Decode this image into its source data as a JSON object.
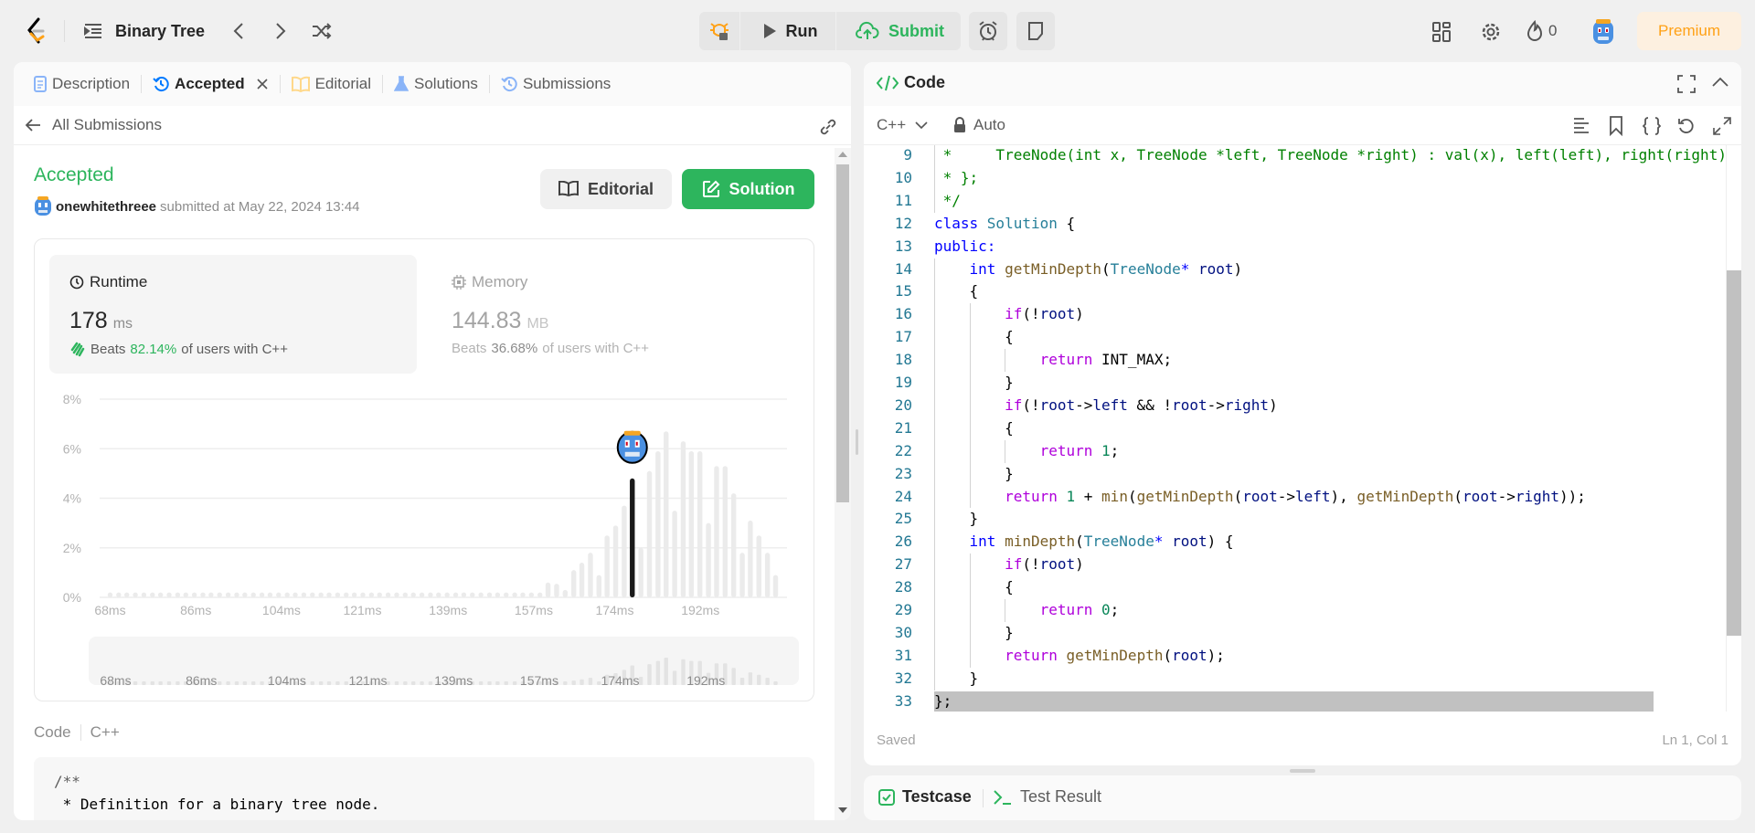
{
  "topbar": {
    "problem_list_label": "Binary Tree",
    "run_label": "Run",
    "submit_label": "Submit",
    "streak_count": "0",
    "premium_label": "Premium",
    "colors": {
      "submit": "#2db55d",
      "premium_text": "#ffa116",
      "premium_bg": "#fdf0e0"
    }
  },
  "left": {
    "tabs": [
      {
        "label": "Description",
        "icon": "description-icon"
      },
      {
        "label": "Accepted",
        "icon": "history-icon",
        "active": true,
        "closable": true
      },
      {
        "label": "Editorial",
        "icon": "book-icon"
      },
      {
        "label": "Solutions",
        "icon": "flask-icon"
      },
      {
        "label": "Submissions",
        "icon": "history-icon"
      }
    ],
    "back_label": "All Submissions",
    "status": "Accepted",
    "username": "onewhitethreee",
    "submitted_text": "submitted at May 22, 2024 13:44",
    "editorial_button": "Editorial",
    "solution_button": "Solution",
    "runtime": {
      "label": "Runtime",
      "value": "178",
      "unit": "ms",
      "beats_prefix": "Beats",
      "beats_pct": "82.14%",
      "beats_suffix": "of users with C++"
    },
    "memory": {
      "label": "Memory",
      "value": "144.83",
      "unit": "MB",
      "beats_prefix": "Beats",
      "beats_pct": "36.68%",
      "beats_suffix": "of users with C++"
    },
    "code_label": "Code",
    "code_lang": "C++",
    "code_preview": [
      "/**",
      " * Definition for a binary tree node."
    ]
  },
  "chart_data": {
    "type": "bar",
    "xlabel": "",
    "ylabel": "",
    "x_tick_labels": [
      "68ms",
      "86ms",
      "104ms",
      "121ms",
      "139ms",
      "157ms",
      "174ms",
      "192ms"
    ],
    "x_ticks": [
      68,
      86,
      104,
      121,
      139,
      157,
      174,
      192
    ],
    "y_tick_labels": [
      "0%",
      "2%",
      "4%",
      "6%",
      "8%"
    ],
    "y_ticks": [
      0,
      2,
      4,
      6,
      8
    ],
    "ylim": [
      0,
      8
    ],
    "xlim": [
      65.8,
      210.2
    ],
    "grid": true,
    "highlight_x": 177.7,
    "x": [
      68.0,
      69.8,
      71.5,
      73.3,
      75.1,
      76.9,
      78.6,
      80.4,
      82.2,
      83.9,
      85.7,
      87.5,
      89.2,
      91.0,
      92.8,
      94.6,
      96.3,
      98.1,
      99.9,
      101.6,
      103.4,
      105.2,
      106.9,
      108.7,
      110.5,
      112.3,
      114.0,
      115.8,
      117.6,
      119.3,
      121.1,
      122.9,
      124.6,
      126.4,
      128.2,
      130.0,
      131.7,
      133.5,
      135.3,
      137.0,
      138.8,
      140.6,
      142.3,
      144.1,
      145.9,
      147.7,
      149.4,
      151.2,
      153.0,
      154.7,
      156.5,
      158.3,
      160.0,
      161.8,
      163.6,
      165.4,
      167.1,
      168.9,
      170.7,
      172.4,
      174.2,
      176.0,
      177.7,
      179.5,
      181.3,
      183.1,
      184.8,
      186.6,
      188.4,
      190.1,
      191.9,
      193.7,
      195.4,
      197.2,
      199.0,
      200.8,
      202.5,
      204.3,
      206.1,
      207.8
    ],
    "values": [
      0.2,
      0.2,
      0.2,
      0.2,
      0.2,
      0.2,
      0.2,
      0.2,
      0.2,
      0.2,
      0.2,
      0.2,
      0.2,
      0.2,
      0.2,
      0.2,
      0.2,
      0.2,
      0.2,
      0.2,
      0.2,
      0.2,
      0.2,
      0.2,
      0.2,
      0.2,
      0.2,
      0.2,
      0.2,
      0.2,
      0.2,
      0.2,
      0.2,
      0.2,
      0.2,
      0.2,
      0.2,
      0.2,
      0.2,
      0.2,
      0.2,
      0.2,
      0.2,
      0.2,
      0.2,
      0.2,
      0.2,
      0.2,
      0.2,
      0.2,
      0.2,
      0.2,
      0.6,
      0.55,
      0.3,
      1.1,
      1.4,
      1.8,
      0.9,
      2.5,
      2.9,
      3.7,
      4.8,
      2.0,
      5.1,
      5.9,
      6.7,
      3.5,
      6.3,
      5.9,
      5.9,
      3.0,
      5.3,
      5.3,
      4.2,
      1.8,
      3.1,
      2.5,
      1.8,
      0.9
    ],
    "colors": {
      "bar": "#ebebeb",
      "highlight": "#1a1a1a"
    }
  },
  "editor": {
    "title": "Code",
    "language": "C++",
    "mode": "Auto",
    "status": "Saved",
    "cursor": "Ln 1, Col 1",
    "lines": [
      {
        "n": "9",
        "t": [
          [
            "comment",
            " *     TreeNode(int x, TreeNode *left, TreeNode *right) : val(x), left(left), right(right)"
          ]
        ]
      },
      {
        "n": "10",
        "t": [
          [
            "comment",
            " * };"
          ]
        ]
      },
      {
        "n": "11",
        "t": [
          [
            "comment",
            " */"
          ]
        ]
      },
      {
        "n": "12",
        "t": [
          [
            "kw",
            "class "
          ],
          [
            "type",
            "Solution"
          ],
          [
            "plain",
            " {"
          ]
        ]
      },
      {
        "n": "13",
        "t": [
          [
            "kw",
            "public:"
          ]
        ]
      },
      {
        "n": "14",
        "t": [
          [
            "plain",
            "    "
          ],
          [
            "kw",
            "int "
          ],
          [
            "fn",
            "getMinDepth"
          ],
          [
            "plain",
            "("
          ],
          [
            "type",
            "TreeNode"
          ],
          [
            "kw",
            "*"
          ],
          [
            "var",
            " root"
          ],
          [
            "plain",
            ")"
          ]
        ]
      },
      {
        "n": "15",
        "t": [
          [
            "plain",
            "    {"
          ]
        ]
      },
      {
        "n": "16",
        "t": [
          [
            "plain",
            "        "
          ],
          [
            "ctl",
            "if"
          ],
          [
            "plain",
            "(!"
          ],
          [
            "var",
            "root"
          ],
          [
            "plain",
            ")"
          ]
        ]
      },
      {
        "n": "17",
        "t": [
          [
            "plain",
            "        {"
          ]
        ]
      },
      {
        "n": "18",
        "t": [
          [
            "plain",
            "            "
          ],
          [
            "ctl",
            "return "
          ],
          [
            "plain",
            "INT_MAX;"
          ]
        ]
      },
      {
        "n": "19",
        "t": [
          [
            "plain",
            "        }"
          ]
        ]
      },
      {
        "n": "20",
        "t": [
          [
            "plain",
            "        "
          ],
          [
            "ctl",
            "if"
          ],
          [
            "plain",
            "(!"
          ],
          [
            "var",
            "root"
          ],
          [
            "plain",
            "->"
          ],
          [
            "var",
            "left"
          ],
          [
            "plain",
            " && !"
          ],
          [
            "var",
            "root"
          ],
          [
            "plain",
            "->"
          ],
          [
            "var",
            "right"
          ],
          [
            "plain",
            ")"
          ]
        ]
      },
      {
        "n": "21",
        "t": [
          [
            "plain",
            "        {"
          ]
        ]
      },
      {
        "n": "22",
        "t": [
          [
            "plain",
            "            "
          ],
          [
            "ctl",
            "return "
          ],
          [
            "num",
            "1"
          ],
          [
            "plain",
            ";"
          ]
        ]
      },
      {
        "n": "23",
        "t": [
          [
            "plain",
            "        }"
          ]
        ]
      },
      {
        "n": "24",
        "t": [
          [
            "plain",
            "        "
          ],
          [
            "ctl",
            "return "
          ],
          [
            "num",
            "1"
          ],
          [
            "plain",
            " + "
          ],
          [
            "fn",
            "min"
          ],
          [
            "plain",
            "("
          ],
          [
            "fn",
            "getMinDepth"
          ],
          [
            "plain",
            "("
          ],
          [
            "var",
            "root"
          ],
          [
            "plain",
            "->"
          ],
          [
            "var",
            "left"
          ],
          [
            "plain",
            "), "
          ],
          [
            "fn",
            "getMinDepth"
          ],
          [
            "plain",
            "("
          ],
          [
            "var",
            "root"
          ],
          [
            "plain",
            "->"
          ],
          [
            "var",
            "right"
          ],
          [
            "plain",
            "));"
          ]
        ]
      },
      {
        "n": "25",
        "t": [
          [
            "plain",
            "    }"
          ]
        ]
      },
      {
        "n": "26",
        "t": [
          [
            "plain",
            "    "
          ],
          [
            "kw",
            "int "
          ],
          [
            "fn",
            "minDepth"
          ],
          [
            "plain",
            "("
          ],
          [
            "type",
            "TreeNode"
          ],
          [
            "kw",
            "*"
          ],
          [
            "var",
            " root"
          ],
          [
            "plain",
            ") {"
          ]
        ]
      },
      {
        "n": "27",
        "t": [
          [
            "plain",
            "        "
          ],
          [
            "ctl",
            "if"
          ],
          [
            "plain",
            "(!"
          ],
          [
            "var",
            "root"
          ],
          [
            "plain",
            ")"
          ]
        ]
      },
      {
        "n": "28",
        "t": [
          [
            "plain",
            "        {"
          ]
        ]
      },
      {
        "n": "29",
        "t": [
          [
            "plain",
            "            "
          ],
          [
            "ctl",
            "return "
          ],
          [
            "num",
            "0"
          ],
          [
            "plain",
            ";"
          ]
        ]
      },
      {
        "n": "30",
        "t": [
          [
            "plain",
            "        }"
          ]
        ]
      },
      {
        "n": "31",
        "t": [
          [
            "plain",
            "        "
          ],
          [
            "ctl",
            "return "
          ],
          [
            "fn",
            "getMinDepth"
          ],
          [
            "plain",
            "("
          ],
          [
            "var",
            "root"
          ],
          [
            "plain",
            ");"
          ]
        ]
      },
      {
        "n": "32",
        "t": [
          [
            "plain",
            "    }"
          ]
        ]
      },
      {
        "n": "33",
        "t": [
          [
            "plain",
            "};"
          ]
        ]
      }
    ]
  },
  "bottom": {
    "testcase_label": "Testcase",
    "result_label": "Test Result"
  }
}
